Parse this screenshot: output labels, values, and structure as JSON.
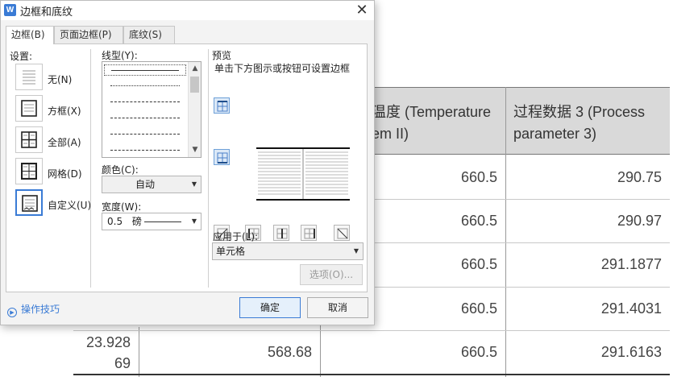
{
  "document": {
    "header": [
      {
        "text": "温度 (Temperature em II)"
      },
      {
        "text": "过程数据 3 (Process parameter 3)"
      }
    ],
    "rows": [
      {
        "c1": "660.5",
        "c2": "290.75"
      },
      {
        "c1": "660.5",
        "c2": "290.97"
      },
      {
        "c1": "660.5",
        "c2": "291.1877"
      },
      {
        "c1": "660.5",
        "c2": "291.4031"
      },
      {
        "c0": "23.928 69",
        "cmid": "568.68",
        "c1": "660.5",
        "c2": "291.6163"
      }
    ]
  },
  "dialog": {
    "title": "边框和底纹",
    "app_icon_letter": "W",
    "close_glyph": "✕",
    "tabs": [
      "边框(B)",
      "页面边框(P)",
      "底纹(S)"
    ],
    "settings": {
      "heading": "设置:",
      "items": [
        "无(N)",
        "方框(X)",
        "全部(A)",
        "网格(D)",
        "自定义(U)"
      ]
    },
    "line_style": {
      "label": "线型(Y):"
    },
    "color": {
      "label": "颜色(C):",
      "value": "自动"
    },
    "width": {
      "label": "宽度(W):",
      "value": "0.5",
      "unit": "磅"
    },
    "preview": {
      "heading": "预览",
      "hint": "单击下方图示或按钮可设置边框"
    },
    "apply_to": {
      "label": "应用于(L):",
      "value": "单元格"
    },
    "options_button": "选项(O)...",
    "ok_button": "确定",
    "cancel_button": "取消",
    "tips_link": "操作技巧"
  }
}
